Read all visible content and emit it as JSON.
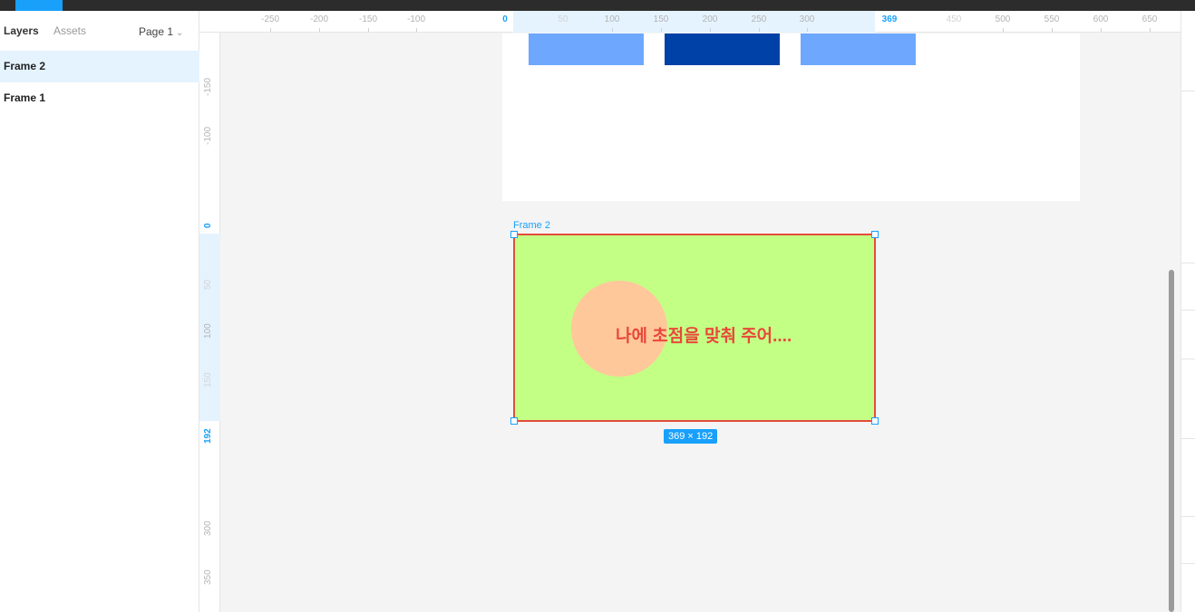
{
  "left_panel": {
    "tabs": [
      "Layers",
      "Assets"
    ],
    "page_selector": "Page 1",
    "layers": [
      "Frame 2",
      "Frame 1"
    ]
  },
  "ruler_top": {
    "labels": [
      "-250",
      "-200",
      "-150",
      "-100",
      "0",
      "50",
      "100",
      "150",
      "200",
      "250",
      "300",
      "369",
      "450",
      "500",
      "550",
      "600",
      "650"
    ]
  },
  "ruler_left": {
    "labels": [
      "-150",
      "-100",
      "0",
      "50",
      "100",
      "150",
      "192",
      "300",
      "350"
    ]
  },
  "canvas": {
    "frame2_label": "Frame 2",
    "overlay_text": "나에 초점을 맞춰 주어....",
    "size_badge": "369 × 192"
  },
  "colors": {
    "selection_blue": "#18a0fb",
    "frame2_fill": "#c4ff85",
    "frame2_border": "#e24c3b",
    "circle_fill": "#ffc89a",
    "text_red": "#e8483a",
    "bar_light": "#6ea8fe",
    "bar_dark": "#0041a8"
  }
}
